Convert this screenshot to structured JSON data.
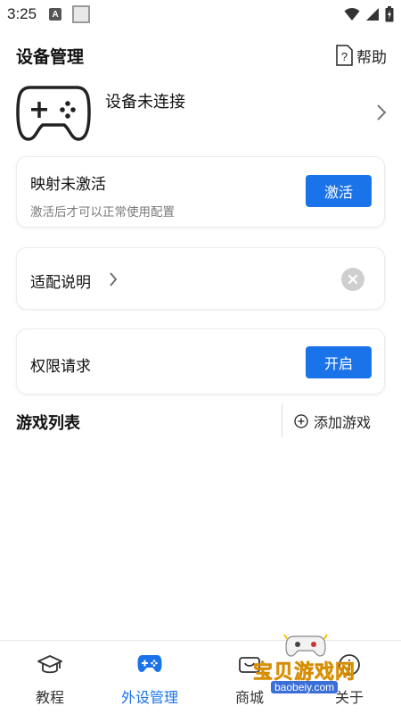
{
  "status_bar": {
    "time": "3:25",
    "notif_letter": "A"
  },
  "header": {
    "title": "设备管理",
    "help_label": "帮助"
  },
  "device": {
    "status": "设备未连接"
  },
  "mapping_card": {
    "title": "映射未激活",
    "subtitle": "激活后才可以正常使用配置",
    "button_label": "激活"
  },
  "adapt_card": {
    "title": "适配说明"
  },
  "permission_card": {
    "title": "权限请求",
    "button_label": "开启"
  },
  "games": {
    "title": "游戏列表",
    "add_label": "添加游戏"
  },
  "bottom_nav": {
    "items": [
      {
        "label": "教程",
        "icon": "graduation-cap-icon",
        "active": false
      },
      {
        "label": "外设管理",
        "icon": "gamepad-icon",
        "active": true
      },
      {
        "label": "商城",
        "icon": "shop-icon",
        "active": false
      },
      {
        "label": "关于",
        "icon": "info-icon",
        "active": false
      }
    ]
  },
  "watermark": {
    "text": "宝贝游戏网",
    "url": "baobeiy.com"
  },
  "colors": {
    "accent": "#1a73e8",
    "text": "#111111",
    "muted": "#7a7a7a",
    "watermark": "#f5c400"
  }
}
